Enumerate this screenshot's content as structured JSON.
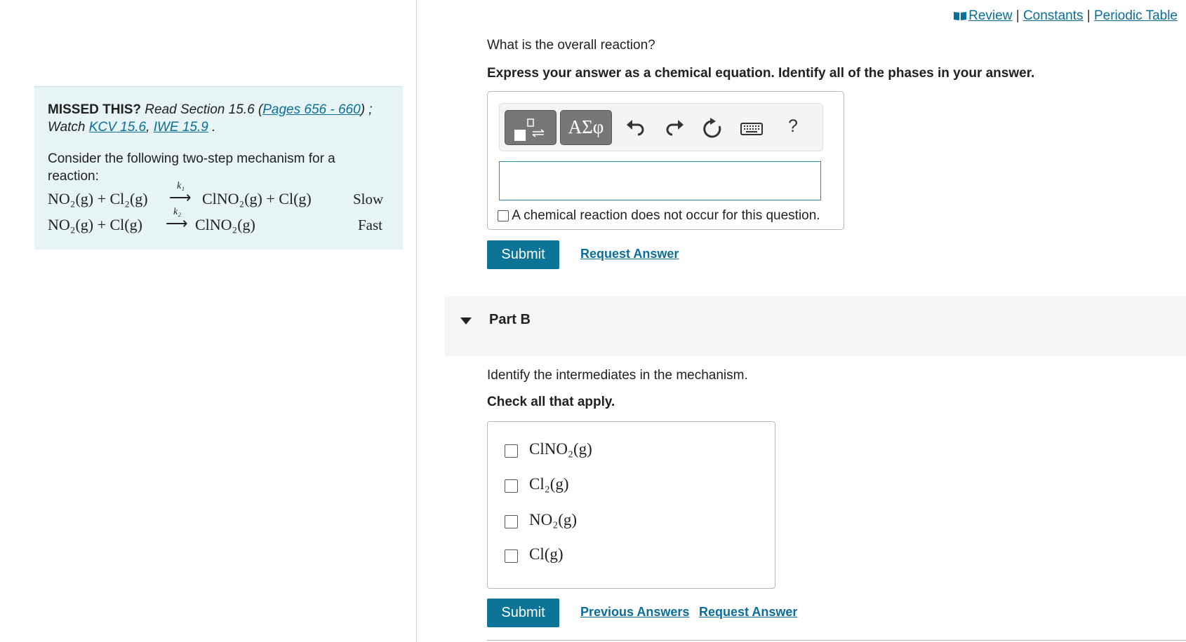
{
  "header": {
    "review": "Review",
    "constants": "Constants",
    "periodic_table": "Periodic Table",
    "separator": "|"
  },
  "hint": {
    "missed": "MISSED THIS?",
    "read": "Read Section 15.6 (",
    "pages_link": "Pages 656 - 660",
    "read_end": ") ;",
    "watch": "Watch",
    "kcv_link": "KCV 15.6",
    "comma": ",",
    "iwe_link": "IWE 15.9",
    "period": ".",
    "intro": "Consider the following two-step mechanism for a reaction:",
    "step1": {
      "reactants": "NO₂(g) + Cl₂(g)",
      "k": "k₁",
      "products": "ClNO₂(g) + Cl(g)",
      "rate": "Slow"
    },
    "step2": {
      "reactants": "NO₂(g) + Cl(g)",
      "k": "k₂",
      "products": "ClNO₂(g)",
      "rate": "Fast"
    }
  },
  "part_a": {
    "question": "What is the overall reaction?",
    "instruction": "Express your answer as a chemical equation. Identify all of the phases in your answer.",
    "toolbar": {
      "greek": "ΑΣφ",
      "help": "?"
    },
    "input_value": "",
    "no_reaction": "A chemical reaction does not occur for this question.",
    "submit": "Submit",
    "request": "Request Answer"
  },
  "part_b": {
    "title": "Part B",
    "question": "Identify the intermediates in the mechanism.",
    "instruction": "Check all that apply.",
    "choices": [
      "ClNO₂(g)",
      "Cl₂(g)",
      "NO₂(g)",
      "Cl(g)"
    ],
    "submit": "Submit",
    "previous": "Previous Answers",
    "request": "Request Answer"
  },
  "colors": {
    "accent": "#0b7497",
    "hint_bg": "#e6f4f5"
  }
}
